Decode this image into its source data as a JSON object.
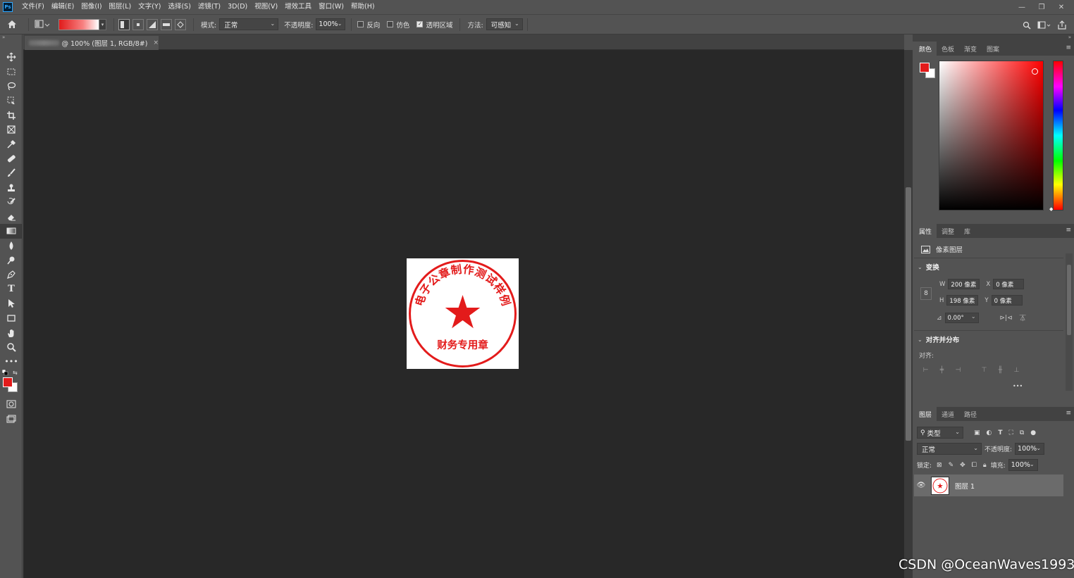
{
  "app": {
    "logo": "Ps"
  },
  "menu": [
    "文件(F)",
    "编辑(E)",
    "图像(I)",
    "图层(L)",
    "文字(Y)",
    "选择(S)",
    "滤镜(T)",
    "3D(D)",
    "视图(V)",
    "增效工具",
    "窗口(W)",
    "帮助(H)"
  ],
  "options": {
    "mode_label": "模式:",
    "mode_value": "正常",
    "opacity_label": "不透明度:",
    "opacity_value": "100%",
    "reverse": "反向",
    "dither": "仿色",
    "transparency": "透明区域",
    "method_label": "方法:",
    "method_value": "可感知",
    "reverse_checked": false,
    "dither_checked": false,
    "transparency_checked": true
  },
  "document": {
    "tab_title": "@ 100% (图层 1, RGB/8#)",
    "tab_close": "×"
  },
  "stamp": {
    "arc_text": "电子公章制作测试样例",
    "bottom_text": "财务专用章",
    "color": "#e31b1b"
  },
  "colors": {
    "foreground": "#e31b1b",
    "background": "#ffffff"
  },
  "color_panel": {
    "tabs": [
      "颜色",
      "色板",
      "渐变",
      "图案"
    ]
  },
  "properties": {
    "tabs": [
      "属性",
      "调整",
      "库"
    ],
    "layer_type": "像素图层",
    "transform_title": "变换",
    "w_label": "W",
    "w_value": "200 像素",
    "h_label": "H",
    "h_value": "198 像素",
    "x_label": "X",
    "x_value": "0 像素",
    "y_label": "Y",
    "y_value": "0 像素",
    "angle_value": "0.00°",
    "align_title": "对齐并分布",
    "align_label": "对齐:",
    "more": "•••"
  },
  "layers": {
    "tabs": [
      "图层",
      "通道",
      "路径"
    ],
    "filter_label": "类型",
    "blend_mode": "正常",
    "opacity_label": "不透明度:",
    "opacity_value": "100%",
    "lock_label": "锁定:",
    "fill_label": "填充:",
    "fill_value": "100%",
    "items": [
      {
        "name": "图层 1"
      }
    ]
  },
  "watermark": "CSDN @OceanWaves1993"
}
